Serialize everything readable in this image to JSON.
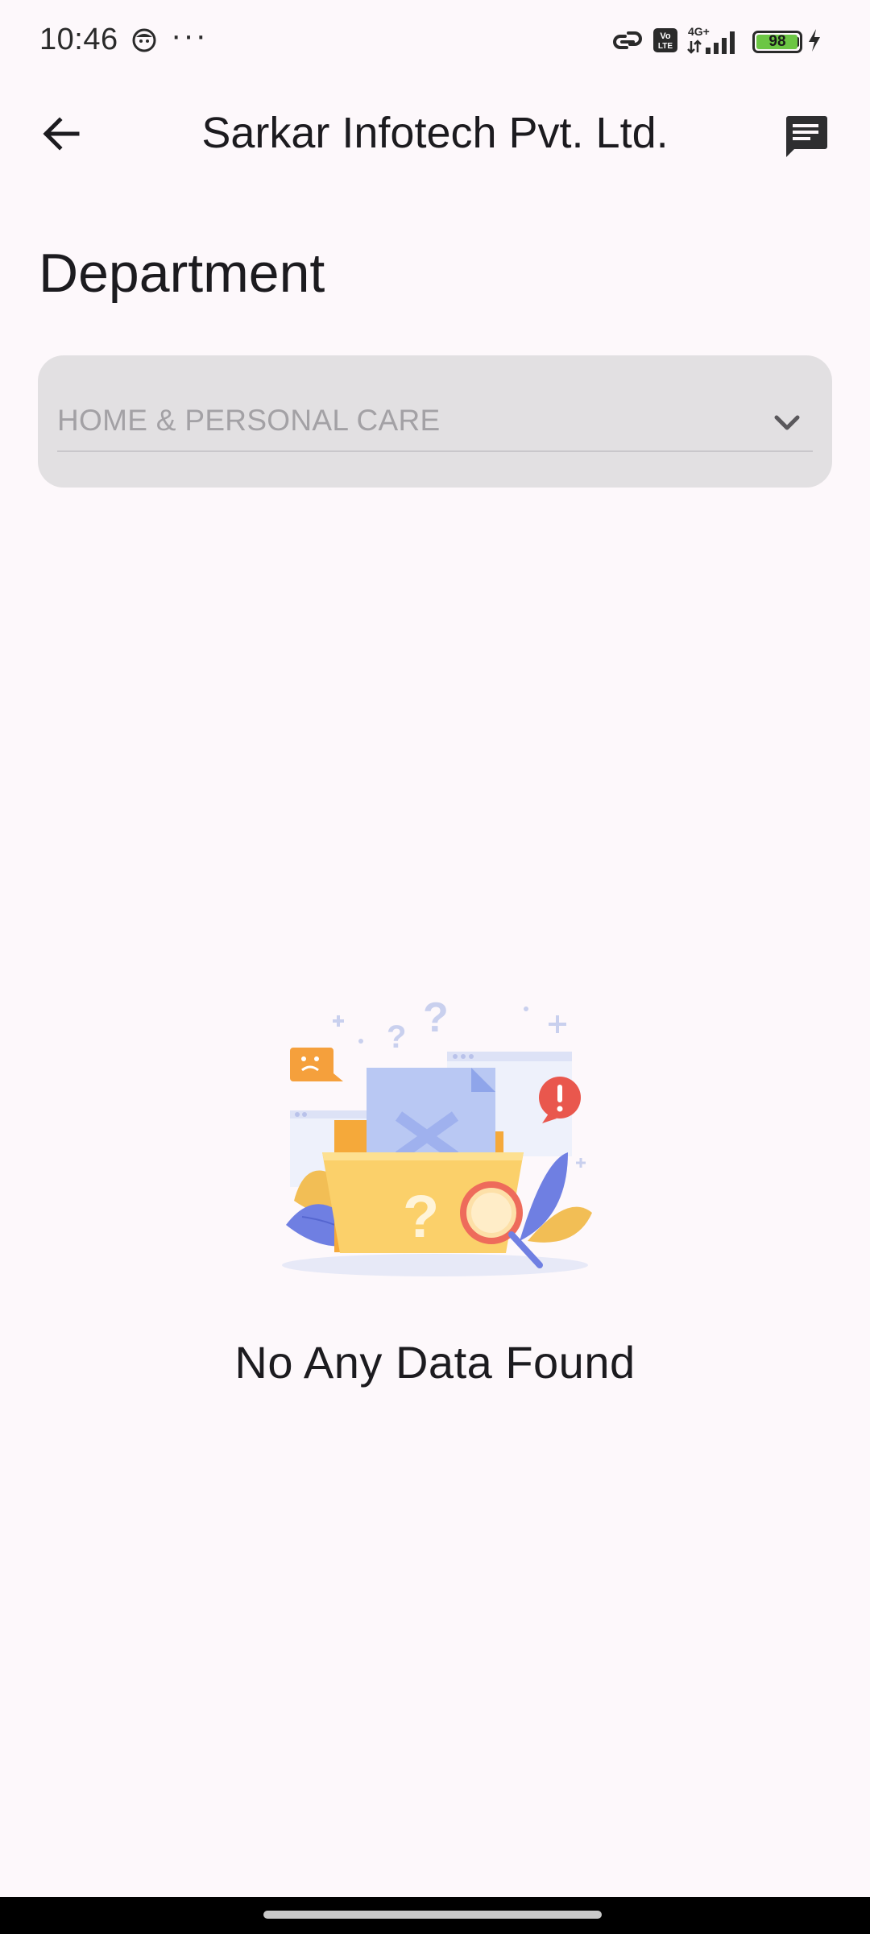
{
  "status_bar": {
    "time": "10:46",
    "overflow_dots": "···",
    "network_type": "4G+",
    "volte_label": "VoLTE",
    "battery_level": "98",
    "battery_color": "#6cc644"
  },
  "app_bar": {
    "title": "Sarkar Infotech Pvt. Ltd.",
    "back_icon": "arrow-back-icon",
    "action_icon": "chat-icon"
  },
  "page": {
    "section_heading": "Department",
    "dropdown": {
      "selected_value": "HOME & PERSONAL CARE",
      "chevron_icon": "chevron-down-icon"
    },
    "empty_state": {
      "illustration": "empty-folder-illustration",
      "message": "No Any Data Found"
    }
  },
  "colors": {
    "background": "#fdf8fb",
    "dropdown_fill": "#e2e0e2",
    "text_primary": "#1c1b1f",
    "text_hint": "#a3a1a5"
  }
}
